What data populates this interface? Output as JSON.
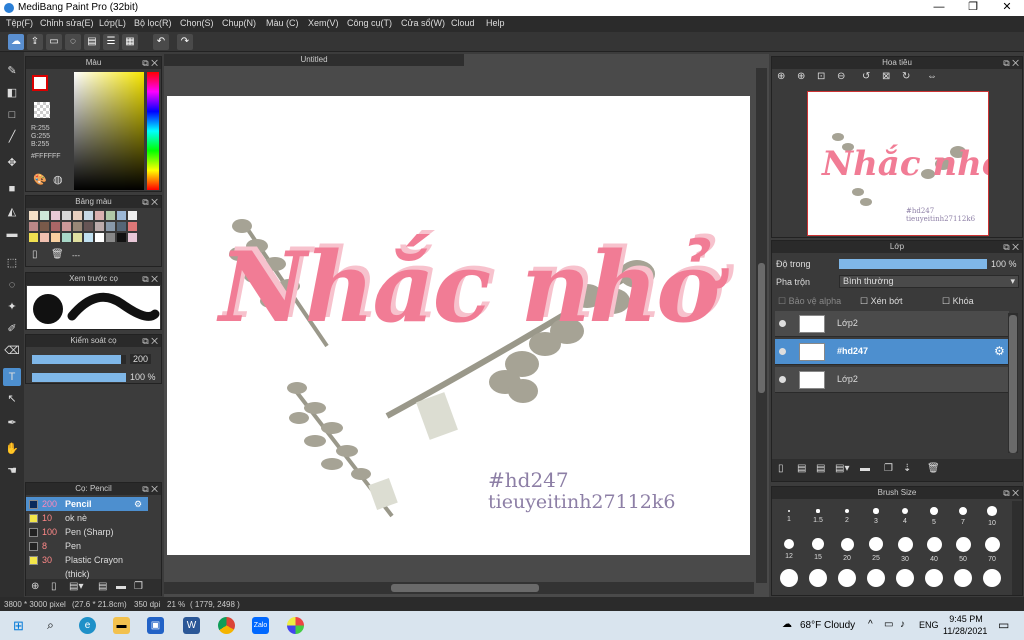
{
  "window": {
    "title": "MediBang Paint Pro (32bit)",
    "controls": [
      "—",
      "❐",
      "✕"
    ]
  },
  "menu": [
    "Tệp(F)",
    "Chỉnh sửa(E)",
    "Lớp(L)",
    "Bộ lọc(R)",
    "Chọn(S)",
    "Chụp(N)",
    "Màu (C)",
    "Xem(V)",
    "Công cụ(T)",
    "Cửa sổ(W)",
    "Cloud",
    "Help"
  ],
  "toolbar": {
    "undo_icon": "undo-icon",
    "redo_icon": "redo-icon"
  },
  "color_panel": {
    "title": "Màu",
    "r": "R:255",
    "g": "G:255",
    "b": "B:255",
    "hex": "#FFFFFF"
  },
  "palette_panel": {
    "title": "Bảng màu",
    "more": "---"
  },
  "brush_preview": {
    "title": "Xem trước cọ"
  },
  "brush_control": {
    "title": "Kiểm soát cọ",
    "size": "200",
    "opacity": "100 %",
    "size_level": 0.95,
    "opacity_level": 1.0
  },
  "brush_panel": {
    "title": "Cọ: Pencil",
    "items": [
      {
        "size": "200",
        "name": "Pencil",
        "color": "#0a2a5a",
        "selected": true
      },
      {
        "size": "10",
        "name": "ok nè",
        "color": "#f3e64a",
        "selected": false
      },
      {
        "size": "100",
        "name": "Pen (Sharp)",
        "color": "#222222",
        "selected": false
      },
      {
        "size": "8",
        "name": "Pen",
        "color": "#222222",
        "selected": false
      },
      {
        "size": "30",
        "name": "Plastic Crayon (thick)",
        "color": "#f3e64a",
        "selected": false
      }
    ]
  },
  "document": {
    "tab": "Untitled"
  },
  "artwork": {
    "title": "Nhắc nhở",
    "tag": "#hd247",
    "credit": "tieuyeitinh27112k6"
  },
  "navigator": {
    "title": "Hoa tiêu"
  },
  "layer_panel": {
    "title": "Lớp",
    "opacity_label": "Độ trong",
    "opacity_value": "100 %",
    "blend_label": "Pha trộn",
    "blend_value": "Bình thường",
    "protect_alpha": "Bảo vệ alpha",
    "clipping": "Xén bớt",
    "lock": "Khóa",
    "layers": [
      {
        "name": "Lớp2",
        "selected": false
      },
      {
        "name": "#hd247",
        "selected": true
      },
      {
        "name": "Lớp2",
        "selected": false
      }
    ]
  },
  "brush_size_panel": {
    "title": "Brush Size",
    "sizes": [
      "1",
      "1.5",
      "2",
      "3",
      "4",
      "5",
      "7",
      "10",
      "12",
      "15",
      "20",
      "25",
      "30",
      "40",
      "50",
      "70"
    ]
  },
  "status": {
    "dimensions": "3800 * 3000 pixel",
    "physical": "(27.6 * 21.8cm)",
    "dpi": "350 dpi",
    "zoom": "21 %",
    "cursor": "( 1779, 2498 )"
  },
  "taskbar": {
    "weather": "68°F  Cloudy",
    "lang": "ENG",
    "time": "9:45 PM",
    "date": "11/28/2021"
  }
}
